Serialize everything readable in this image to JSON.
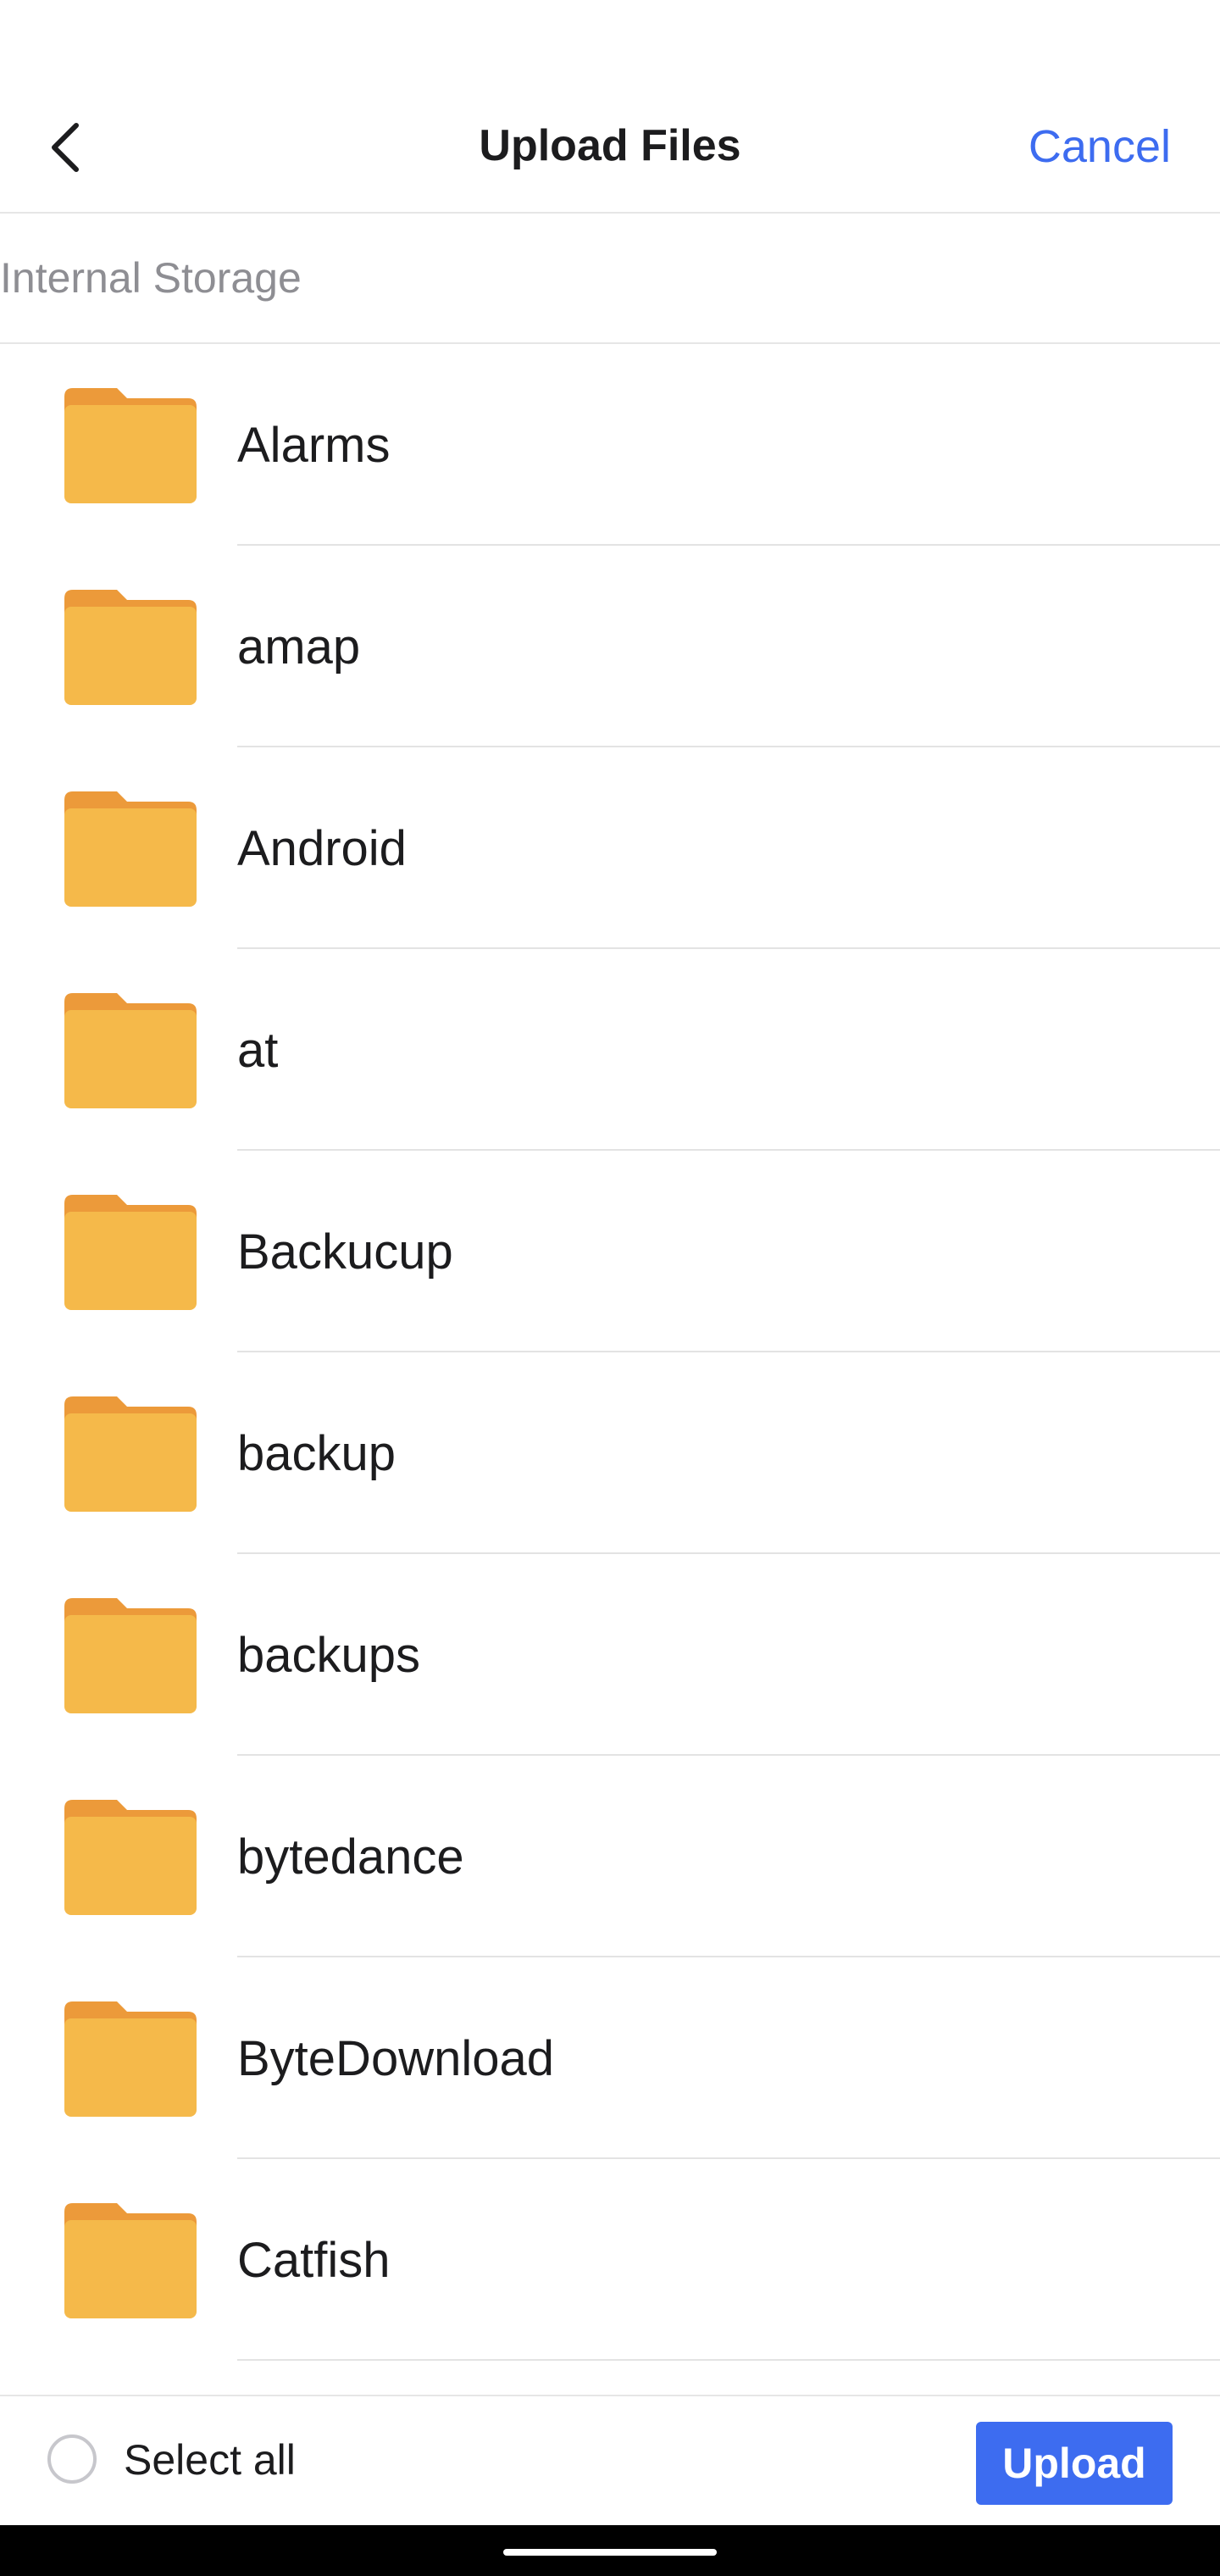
{
  "header": {
    "title": "Upload Files",
    "cancel_label": "Cancel",
    "back_icon": "chevron-left-icon"
  },
  "breadcrumb": {
    "path": "Internal Storage"
  },
  "folders": [
    {
      "name": "Alarms"
    },
    {
      "name": "amap"
    },
    {
      "name": "Android"
    },
    {
      "name": "at"
    },
    {
      "name": "Backucup"
    },
    {
      "name": "backup"
    },
    {
      "name": "backups"
    },
    {
      "name": "bytedance"
    },
    {
      "name": "ByteDownload"
    },
    {
      "name": "Catfish"
    }
  ],
  "footer": {
    "select_all_label": "Select all",
    "upload_label": "Upload"
  },
  "colors": {
    "accent": "#3d6cf0",
    "folder": "#f5b94a",
    "folder_tab": "#ec9a3a"
  }
}
